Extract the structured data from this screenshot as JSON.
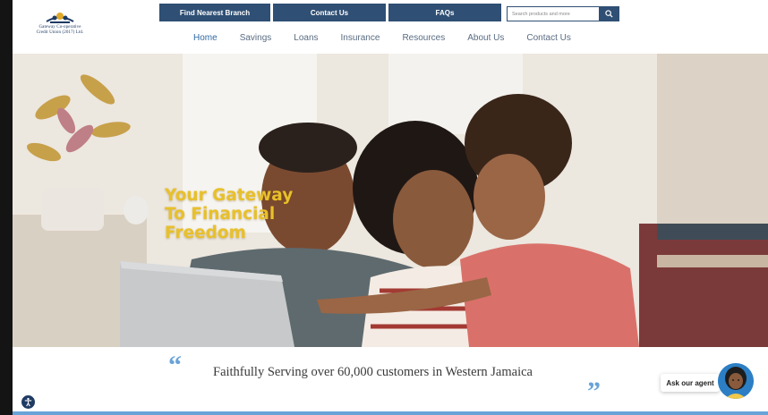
{
  "logo": {
    "line1": "Gateway Co-operative",
    "line2": "Credit Union (2017) Ltd."
  },
  "topbar": {
    "items": [
      "Find Nearest Branch",
      "Contact Us",
      "FAQs"
    ]
  },
  "search": {
    "placeholder": "Search products and more",
    "icon": "search-icon"
  },
  "nav": {
    "items": [
      "Home",
      "Savings",
      "Loans",
      "Insurance",
      "Resources",
      "About Us",
      "Contact Us"
    ],
    "active": "Home"
  },
  "hero": {
    "headline": [
      "Your Gateway",
      "To Financial",
      "Freedom"
    ]
  },
  "tagline": {
    "text": "Faithfully Serving over 60,000 customers in Western Jamaica",
    "open_quote": "66",
    "close_quote": "99"
  },
  "agent": {
    "label": "Ask our agent"
  },
  "colors": {
    "nav_blue": "#2f4f74",
    "accent_blue": "#6aa3d8",
    "headline_gold": "#e8c02a",
    "link_blue": "#2f6aa3"
  }
}
